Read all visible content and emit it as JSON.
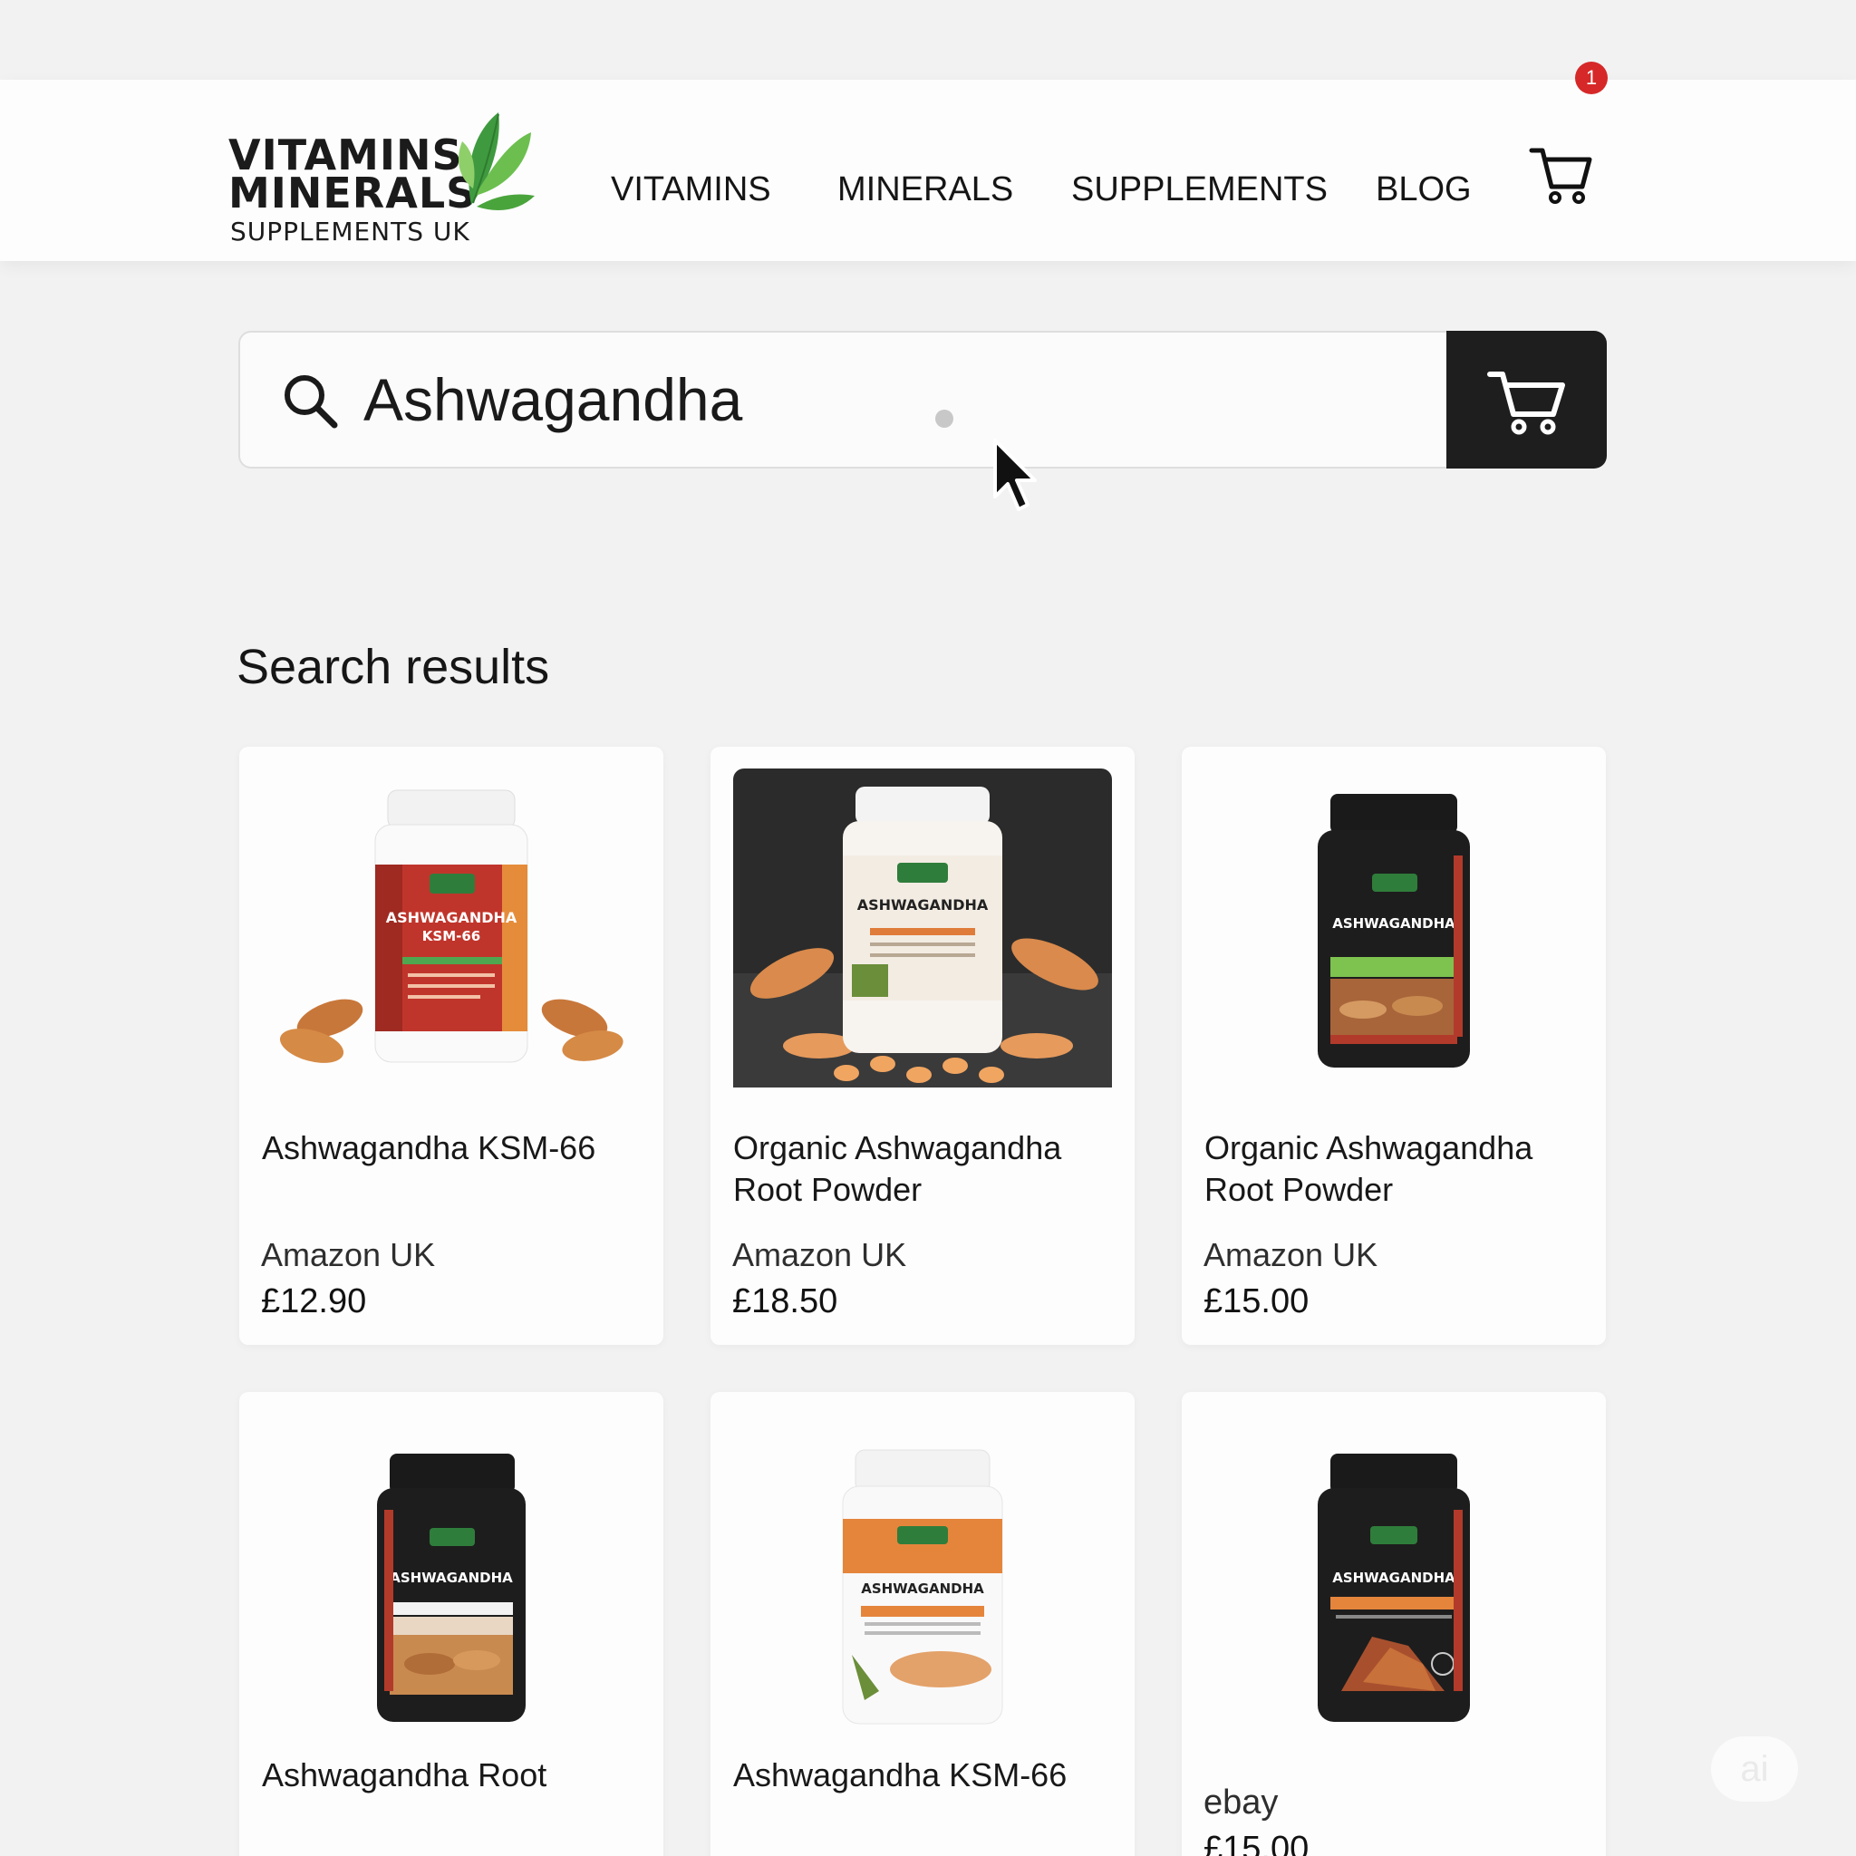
{
  "brand": {
    "line1": "VITAMINS",
    "line2": "MINERALS",
    "line3": "SUPPLEMENTS UK"
  },
  "nav": {
    "items": [
      {
        "label": "VITAMINS"
      },
      {
        "label": "MINERALS"
      },
      {
        "label": "SUPPLEMENTS"
      },
      {
        "label": "BLOG"
      }
    ]
  },
  "cart": {
    "count": "1",
    "icon": "cart-icon"
  },
  "search": {
    "value": "Ashwagandha",
    "icon": "search-icon",
    "button_icon": "cart-icon"
  },
  "results": {
    "title": "Search results",
    "products": [
      {
        "name": "Ashwagandha KSM-66",
        "store": "Amazon UK",
        "price": "£12.90"
      },
      {
        "name": "Organic Ashwagandha Root Powder",
        "store": "Amazon UK",
        "price": "£18.50"
      },
      {
        "name": "Organic Ashwagandha Root Powder",
        "store": "Amazon UK",
        "price": "£15.00"
      },
      {
        "name": "Ashwagandha Root",
        "store": "",
        "price": ""
      },
      {
        "name": "Ashwagandha KSM-66",
        "store": "",
        "price": ""
      },
      {
        "name": "",
        "store": "ebay",
        "price": "£15.00"
      }
    ]
  },
  "colors": {
    "background": "#f2f2f2",
    "header": "#fdfdfd",
    "search_button": "#1e1e1e",
    "badge": "#d62828",
    "logo_green": "#3f9a3f"
  }
}
